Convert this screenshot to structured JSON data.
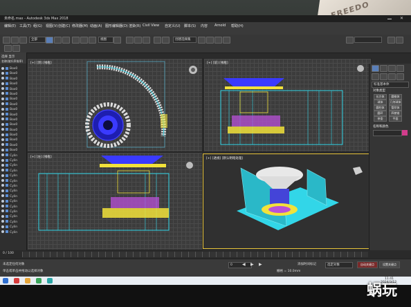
{
  "window": {
    "title": "未命名.max - Autodesk 3ds Max 2018"
  },
  "poster": {
    "text": "FREEDO"
  },
  "menu": {
    "items": [
      "编辑(E)",
      "工具(T)",
      "组(G)",
      "视图(V)",
      "创建(C)",
      "修改器(M)",
      "动画(A)",
      "图形编辑器(D)",
      "渲染(R)",
      "Civil View",
      "自定义(U)",
      "脚本(S)",
      "内容",
      "Arnold",
      "帮助(H)"
    ]
  },
  "toolbar": {
    "selection_filter": "全部",
    "view_dropdown": "视图",
    "selection_set": "创建选择集"
  },
  "explorer": {
    "tabs": "选择  显示",
    "header": "名称(按升序排序)",
    "rows": [
      "Box0",
      "Box0",
      "Box0",
      "Box0",
      "Box0",
      "Box0",
      "Box0",
      "Box0",
      "Box0",
      "Box0",
      "Box0",
      "Box0",
      "Box0",
      "Box0",
      "Box0",
      "Box0",
      "Box0",
      "Cylin",
      "Cylin",
      "Cylin",
      "Cylin",
      "Cylin",
      "Cylin",
      "Cylin",
      "Cylin",
      "Cylin",
      "Cylin",
      "Cylin",
      "Cylin",
      "Cylin",
      "Cylin",
      "Cylin",
      "Cylin"
    ]
  },
  "viewports": {
    "top": "[+] [顶] [线框]",
    "front": "[+] [前] [线框]",
    "left": "[+] [左] [线框]",
    "perspective": "[+] [透视] [默认明暗处理]"
  },
  "command_panel": {
    "object_type_header": "对象类型",
    "name_color_header": "名称和颜色",
    "buttons": [
      "长方体",
      "圆锥体",
      "球体",
      "几何球体",
      "圆柱体",
      "管状体",
      "圆环",
      "四棱锥",
      "茶壶",
      "平面"
    ],
    "standard_primitives": "标准基本体"
  },
  "statusbar": {
    "selected": "未选定任何对象",
    "prompt": "单击或单击并拖动以选择对象",
    "frame_counter": "0 / 100",
    "autokey": "自动关键点",
    "set_key": "设置关键点",
    "selected_dd": "选定对象",
    "add_time_tag": "添加时间标记",
    "grid": "栅格 = 10.0mm",
    "frame_field": "0"
  },
  "taskbar": {
    "time": "11:41",
    "date": "2024/3/12"
  },
  "watermark": {
    "text": "蜗玩"
  },
  "colors": {
    "accent_yellow": "#e8c43a",
    "model_blue": "#3a3aff",
    "model_cyan": "#32d6e8",
    "model_yellow": "#f2e23a"
  }
}
